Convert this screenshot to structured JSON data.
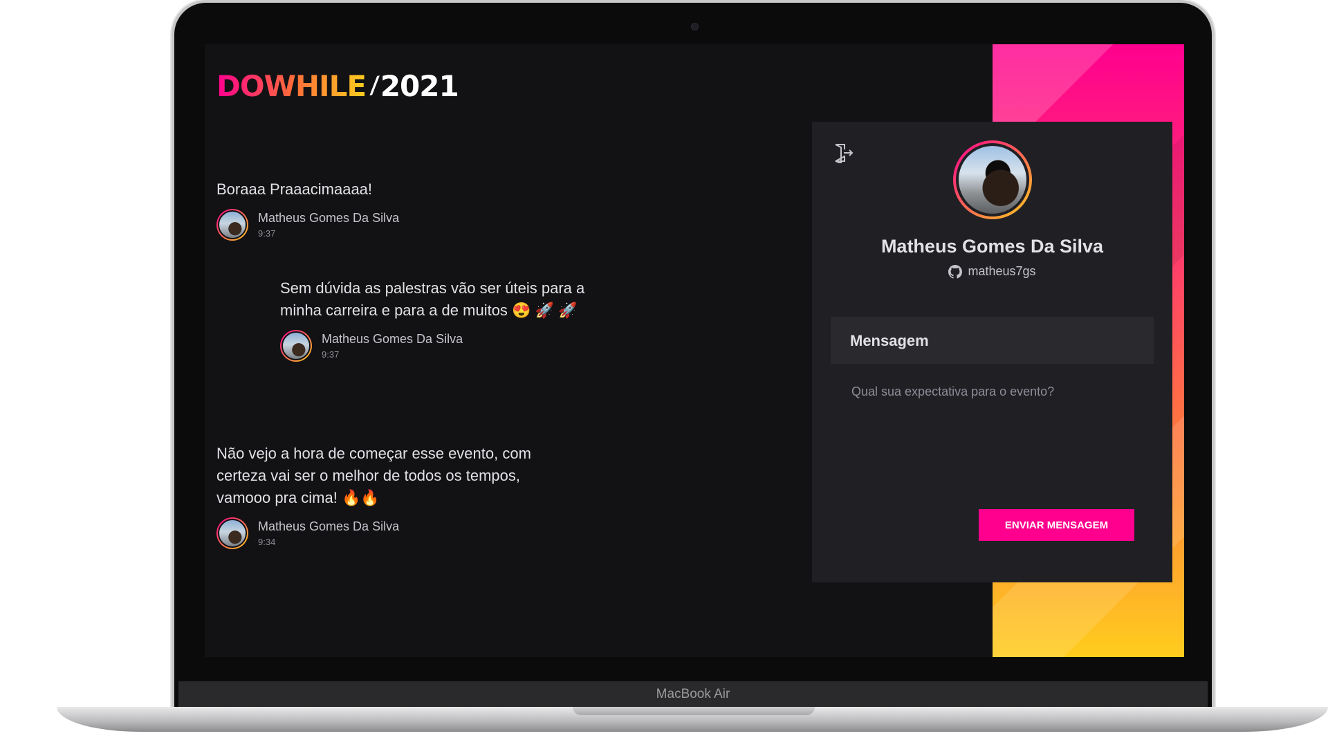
{
  "device": {
    "label": "MacBook Air"
  },
  "header": {
    "logo_part1": "DOWHILE",
    "logo_mark": "⁄",
    "logo_year": "2021"
  },
  "messages": [
    {
      "text": "Boraaa Praaacimaaaa!",
      "author": "Matheus Gomes Da Silva",
      "time": "9:37"
    },
    {
      "text": "Sem dúvida as palestras vão ser úteis para a minha carreira e para a de muitos 😍 🚀 🚀",
      "author": "Matheus Gomes Da Silva",
      "time": "9:37"
    },
    {
      "text": "Não vejo a hora de começar esse evento, com certeza vai ser o melhor de todos os tempos, vamooo pra cima! 🔥🔥",
      "author": "Matheus Gomes Da Silva",
      "time": "9:34"
    }
  ],
  "profile": {
    "name": "Matheus Gomes Da Silva",
    "login": "matheus7gs",
    "signout_icon": "sign-out-icon",
    "github_icon": "github-icon"
  },
  "form": {
    "title": "Mensagem",
    "placeholder": "Qual sua expectativa para o evento?",
    "value": "",
    "submit_label": "ENVIAR MENSAGEM"
  },
  "colors": {
    "accent_pink": "#ff008e",
    "accent_yellow": "#ffcd1e",
    "background": "#121214",
    "card": "#202024"
  }
}
